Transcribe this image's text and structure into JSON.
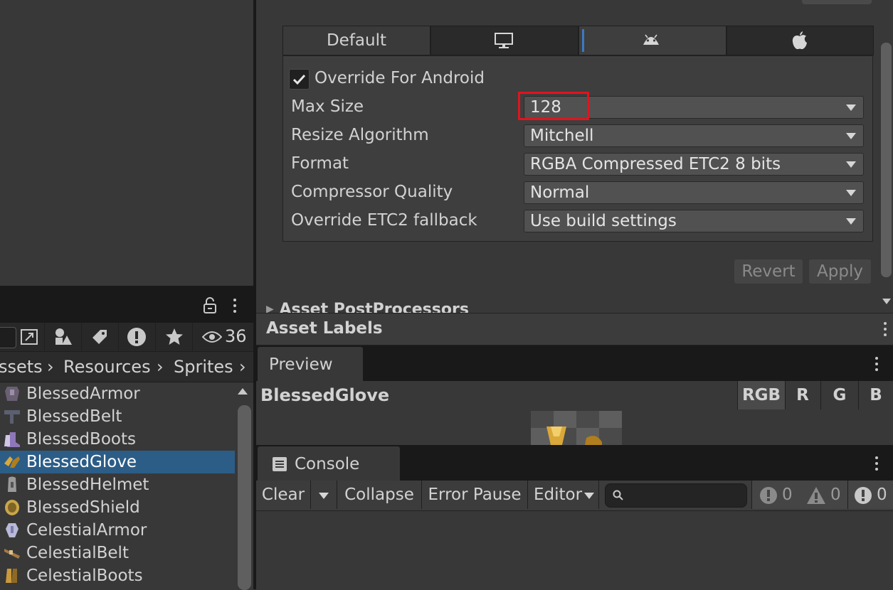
{
  "project": {
    "filter_count": "36",
    "breadcrumb": [
      "ssets",
      "Resources",
      "Sprites"
    ],
    "items": [
      {
        "label": "BlessedArmor",
        "icon": "armor-icon",
        "color": "#6b5f74"
      },
      {
        "label": "BlessedBelt",
        "icon": "belt-icon",
        "color": "#5b5f70"
      },
      {
        "label": "BlessedBoots",
        "icon": "boots-icon",
        "color": "#8d77b8"
      },
      {
        "label": "BlessedGlove",
        "icon": "glove-icon",
        "color": "#d9a73a"
      },
      {
        "label": "BlessedHelmet",
        "icon": "helmet-icon",
        "color": "#9a9a9a"
      },
      {
        "label": "BlessedShield",
        "icon": "shield-icon",
        "color": "#c9a64a"
      },
      {
        "label": "CelestialArmor",
        "icon": "armor-icon",
        "color": "#b9b9d8"
      },
      {
        "label": "CelestialBelt",
        "icon": "belt-icon",
        "color": "#a57a45"
      },
      {
        "label": "CelestialBoots",
        "icon": "boots-icon",
        "color": "#c99a3c"
      }
    ],
    "selected_index": 3
  },
  "inspector": {
    "platform_tabs": [
      {
        "label": "Default",
        "icon": ""
      },
      {
        "label": "",
        "icon": "monitor-icon"
      },
      {
        "label": "",
        "icon": "android-icon"
      },
      {
        "label": "",
        "icon": "apple-icon"
      }
    ],
    "active_tab": 2,
    "override_label": "Override For Android",
    "override_checked": true,
    "rows": [
      {
        "label": "Max Size",
        "value": "128"
      },
      {
        "label": "Resize Algorithm",
        "value": "Mitchell"
      },
      {
        "label": "Format",
        "value": "RGBA Compressed ETC2 8 bits"
      },
      {
        "label": "Compressor Quality",
        "value": "Normal"
      },
      {
        "label": "Override ETC2 fallback",
        "value": "Use build settings"
      }
    ],
    "highlight_color": "#e0141e",
    "revert_label": "Revert",
    "apply_label": "Apply",
    "postprocessors_label": "Asset PostProcessors"
  },
  "asset_labels": {
    "title": "Asset Labels"
  },
  "preview": {
    "tab_label": "Preview",
    "asset_name": "BlessedGlove",
    "channels": [
      "RGB",
      "R",
      "G",
      "B"
    ]
  },
  "console": {
    "tab_label": "Console",
    "clear_label": "Clear",
    "collapse_label": "Collapse",
    "error_pause_label": "Error Pause",
    "editor_label": "Editor",
    "search_placeholder": "",
    "info_count": "0",
    "warning_count": "0",
    "error_count": "0"
  },
  "colors": {
    "selection": "#2c5d87",
    "accent": "#3a79c7",
    "bg": "#383838"
  }
}
